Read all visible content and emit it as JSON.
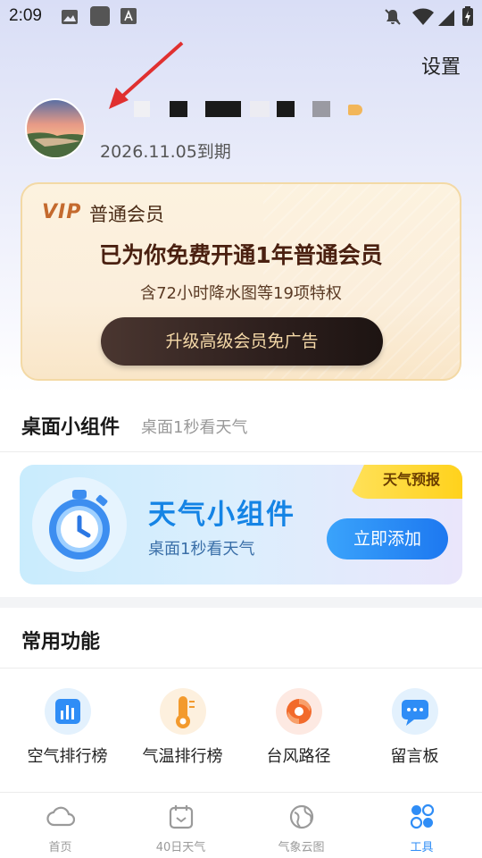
{
  "status_bar": {
    "time": "2:09"
  },
  "header": {
    "settings_label": "设置"
  },
  "profile": {
    "expiry_text": "2026.11.05到期"
  },
  "vip_card": {
    "logo": "VIP",
    "label": "普通会员",
    "title": "已为你免费开通1年普通会员",
    "subtitle": "含72小时降水图等19项特权",
    "button_label": "升级高级会员免广告"
  },
  "widget_section": {
    "title": "桌面小组件",
    "subtitle": "桌面1秒看天气",
    "card": {
      "tag": "天气预报",
      "title": "天气小组件",
      "subtitle": "桌面1秒看天气",
      "button_label": "立即添加"
    }
  },
  "common_functions": {
    "title": "常用功能",
    "items": [
      {
        "label": "空气排行榜",
        "icon": "bar-chart-icon"
      },
      {
        "label": "气温排行榜",
        "icon": "thermometer-icon"
      },
      {
        "label": "台风路径",
        "icon": "typhoon-icon"
      },
      {
        "label": "留言板",
        "icon": "message-board-icon"
      }
    ]
  },
  "bottom_nav": {
    "items": [
      {
        "label": "首页",
        "icon": "cloud-icon",
        "active": false
      },
      {
        "label": "40日天气",
        "icon": "calendar-icon",
        "active": false
      },
      {
        "label": "气象云图",
        "icon": "globe-icon",
        "active": false
      },
      {
        "label": "工具",
        "icon": "tools-icon",
        "active": true
      }
    ]
  },
  "colors": {
    "accent_blue": "#2f8df6",
    "vip_brown": "#4a2010",
    "vip_gold": "#f5d9a8",
    "tag_yellow": "#ffd21c"
  }
}
